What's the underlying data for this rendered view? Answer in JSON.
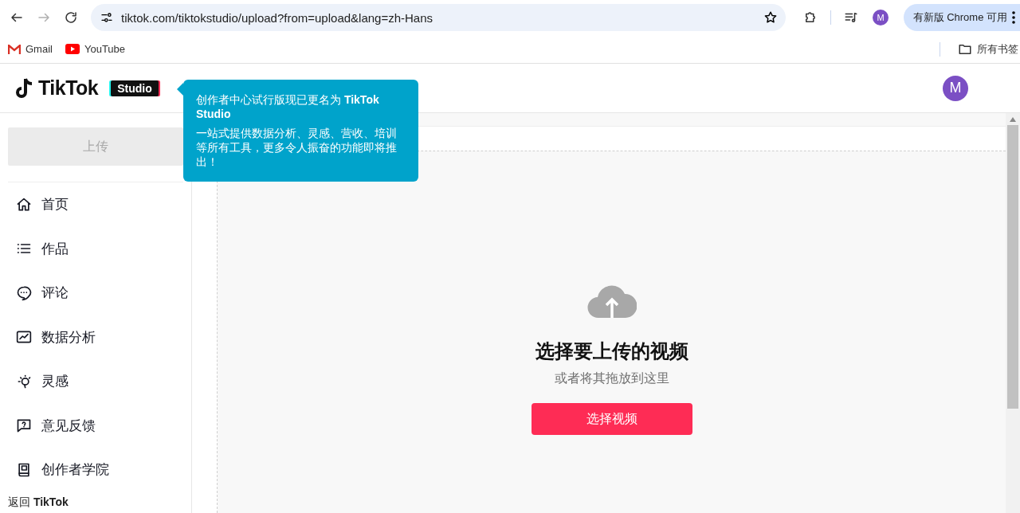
{
  "browser": {
    "back_disabled": false,
    "forward_disabled": true,
    "url": "tiktok.com/tiktokstudio/upload?from=upload&lang=zh-Hans",
    "profile_initial": "M",
    "update_label": "有新版 Chrome 可用",
    "bookmarks": [
      {
        "label": "Gmail",
        "kind": "gmail"
      },
      {
        "label": "YouTube",
        "kind": "youtube"
      }
    ],
    "all_bookmarks": "所有书签"
  },
  "header": {
    "logo_text": "TikTok",
    "badge": "Studio",
    "avatar_initial": "M"
  },
  "tooltip": {
    "title": "创作者中心试行版现已更名为 **TikTok Studio**",
    "body": "一站式提供数据分析、灵感、营收、培训等所有工具，更多令人振奋的功能即将推出！"
  },
  "sidebar": {
    "upload_button": {
      "label": "上传",
      "disabled": true
    },
    "items": [
      {
        "label": "首页",
        "kind": "home"
      },
      {
        "label": "作品",
        "kind": "list"
      },
      {
        "label": "评论",
        "kind": "comment"
      },
      {
        "label": "数据分析",
        "kind": "chart"
      },
      {
        "label": "灵感",
        "kind": "bulb"
      },
      {
        "label": "意见反馈",
        "kind": "feedback"
      },
      {
        "label": "创作者学院",
        "kind": "academy"
      }
    ],
    "back_link": "返回 **TikTok**"
  },
  "upload": {
    "title": "选择要上传的视频",
    "subtitle": "或者将其拖放到这里",
    "button": "选择视频"
  }
}
